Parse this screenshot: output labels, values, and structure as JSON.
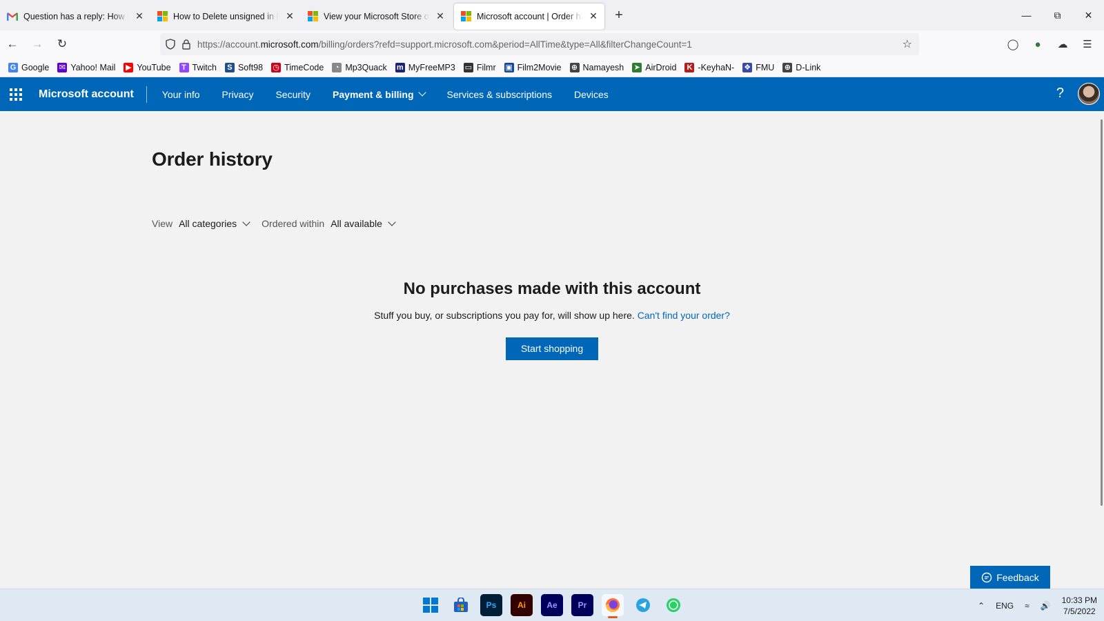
{
  "browser": {
    "tabs": [
      {
        "label": "Question has a reply: How to Delete",
        "icon": "gmail-icon",
        "active": false
      },
      {
        "label": "How to Delete unsigned in Microsoft",
        "icon": "microsoft-icon",
        "active": false
      },
      {
        "label": "View your Microsoft Store order",
        "icon": "microsoft-icon",
        "active": false
      },
      {
        "label": "Microsoft account | Order history",
        "icon": "microsoft-icon",
        "active": true
      }
    ],
    "new_tab": "+",
    "url_prefix": "https://account.",
    "url_domain": "microsoft.com",
    "url_path": "/billing/orders?refd=support.microsoft.com&period=AllTime&type=All&filterChangeCount=1",
    "bookmarks": [
      {
        "label": "Google",
        "icon": "google-icon",
        "color": "#4285f4"
      },
      {
        "label": "Yahoo! Mail",
        "icon": "yahoo-mail-icon",
        "color": "#6001d2"
      },
      {
        "label": "YouTube",
        "icon": "youtube-icon",
        "color": "#ff0000"
      },
      {
        "label": "Twitch",
        "icon": "twitch-icon",
        "color": "#9146ff"
      },
      {
        "label": "Soft98",
        "icon": "soft98-icon",
        "color": "#1f4e8c"
      },
      {
        "label": "TimeCode",
        "icon": "timer-icon",
        "color": "#d0021b"
      },
      {
        "label": "Mp3Quack",
        "icon": "duck-icon",
        "color": "#888888"
      },
      {
        "label": "MyFreeMP3",
        "icon": "myfreemp3-icon",
        "color": "#1a237e"
      },
      {
        "label": "Filmr",
        "icon": "monitor-icon",
        "color": "#333333"
      },
      {
        "label": "Film2Movie",
        "icon": "tv-icon",
        "color": "#0d47a1"
      },
      {
        "label": "Namayesh",
        "icon": "globe-icon",
        "color": "#444444"
      },
      {
        "label": "AirDroid",
        "icon": "airdroid-icon",
        "color": "#2e7d32"
      },
      {
        "label": "-KeyhaN-",
        "icon": "keyhan-icon",
        "color": "#b71c1c"
      },
      {
        "label": "FMU",
        "icon": "fmu-icon",
        "color": "#3949ab"
      },
      {
        "label": "D-Link",
        "icon": "globe-icon",
        "color": "#444444"
      }
    ]
  },
  "ms_header": {
    "brand": "Microsoft account",
    "nav": [
      {
        "label": "Your info",
        "bold": false,
        "dropdown": false
      },
      {
        "label": "Privacy",
        "bold": false,
        "dropdown": false
      },
      {
        "label": "Security",
        "bold": false,
        "dropdown": false
      },
      {
        "label": "Payment & billing",
        "bold": true,
        "dropdown": true
      },
      {
        "label": "Services & subscriptions",
        "bold": false,
        "dropdown": false
      },
      {
        "label": "Devices",
        "bold": false,
        "dropdown": false
      }
    ],
    "help": "?",
    "accent_color": "#0067b8"
  },
  "page": {
    "title": "Order history",
    "filters": {
      "view_label": "View",
      "view_value": "All categories",
      "within_label": "Ordered within",
      "within_value": "All available"
    },
    "empty": {
      "heading": "No purchases made with this account",
      "text": "Stuff you buy, or subscriptions you pay for, will show up here.",
      "link": "Can't find your order?",
      "button": "Start shopping"
    },
    "feedback": "Feedback"
  },
  "taskbar": {
    "apps": [
      {
        "label": "",
        "icon": "windows-start-icon",
        "active": false
      },
      {
        "label": "",
        "icon": "microsoft-store-icon",
        "active": false
      },
      {
        "label": "Ps",
        "icon": "photoshop-icon",
        "active": false
      },
      {
        "label": "Ai",
        "icon": "illustrator-icon",
        "active": false
      },
      {
        "label": "Ae",
        "icon": "after-effects-icon",
        "active": false
      },
      {
        "label": "Pr",
        "icon": "premiere-icon",
        "active": false
      },
      {
        "label": "",
        "icon": "firefox-icon",
        "active": true
      },
      {
        "label": "",
        "icon": "telegram-icon",
        "active": false
      },
      {
        "label": "",
        "icon": "whatsapp-icon",
        "active": false
      }
    ],
    "language": "ENG",
    "time": "10:33 PM",
    "date": "7/5/2022"
  }
}
